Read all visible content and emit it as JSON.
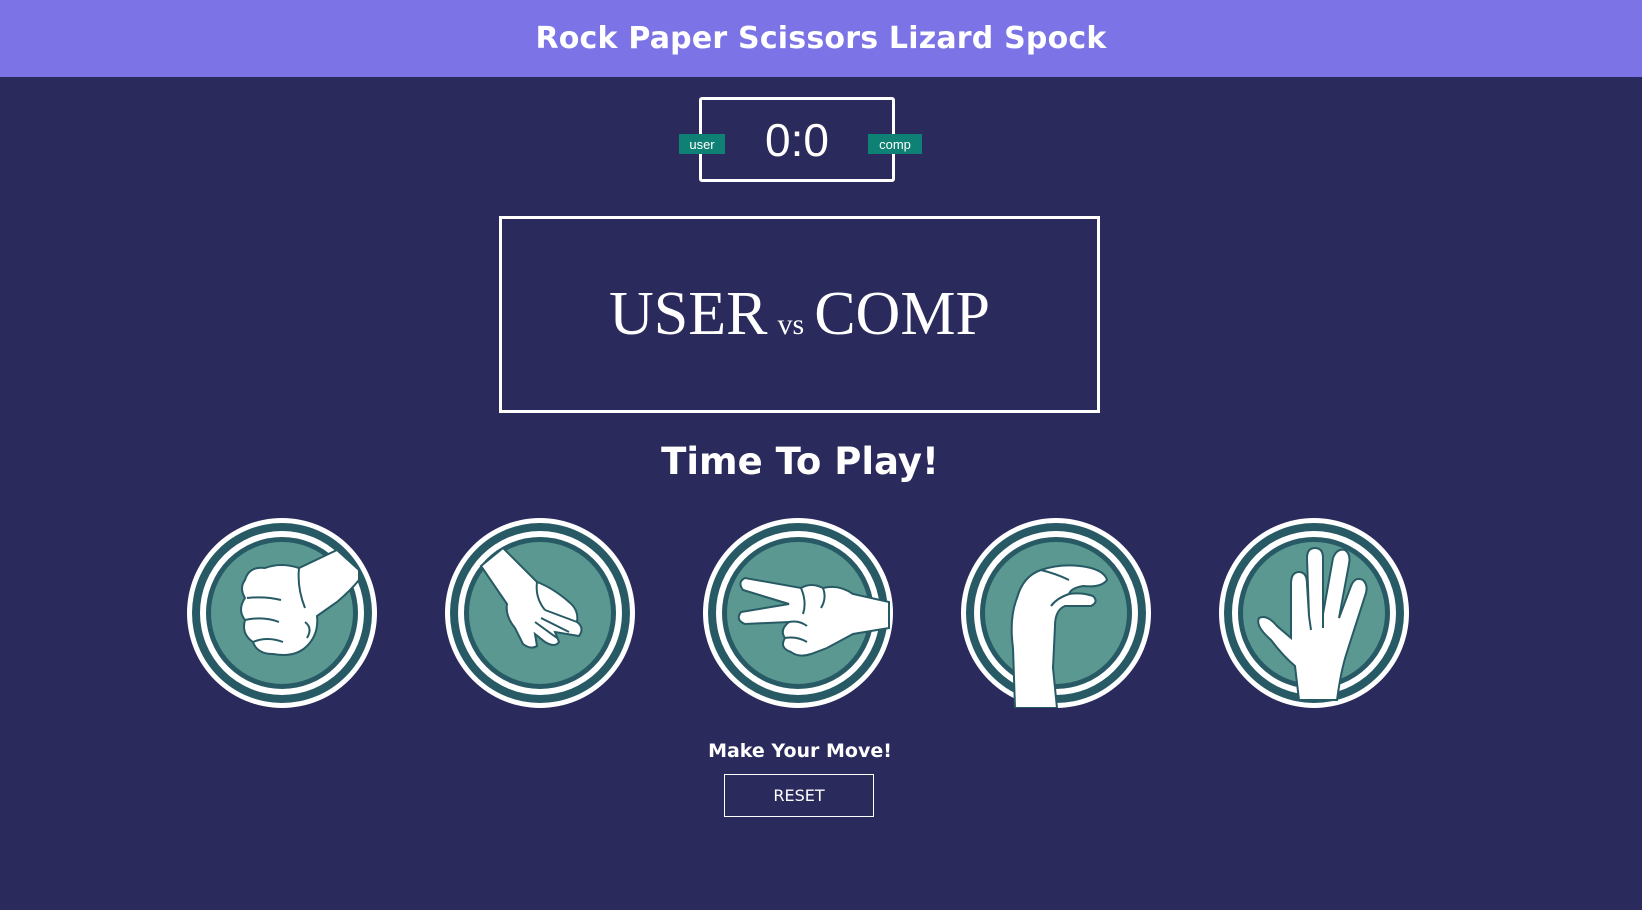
{
  "header": {
    "title": "Rock Paper Scissors Lizard Spock"
  },
  "scoreboard": {
    "score": "0:0",
    "user_badge": "user",
    "comp_badge": "comp"
  },
  "result": {
    "left": "USER",
    "vs": "vs",
    "right": "COMP"
  },
  "prompt": "Time To Play!",
  "choices": [
    {
      "name": "rock",
      "icon": "rock-fist-icon"
    },
    {
      "name": "paper",
      "icon": "paper-hand-icon"
    },
    {
      "name": "scissors",
      "icon": "scissors-hand-icon"
    },
    {
      "name": "lizard",
      "icon": "lizard-hand-icon"
    },
    {
      "name": "spock",
      "icon": "spock-hand-icon"
    }
  ],
  "move_label": "Make Your Move!",
  "reset_label": "RESET",
  "colors": {
    "background": "#2b2a5c",
    "header": "#7c74e6",
    "badge": "#0f8074",
    "choice_ring": "#275a64",
    "choice_fill": "#5a9891"
  }
}
